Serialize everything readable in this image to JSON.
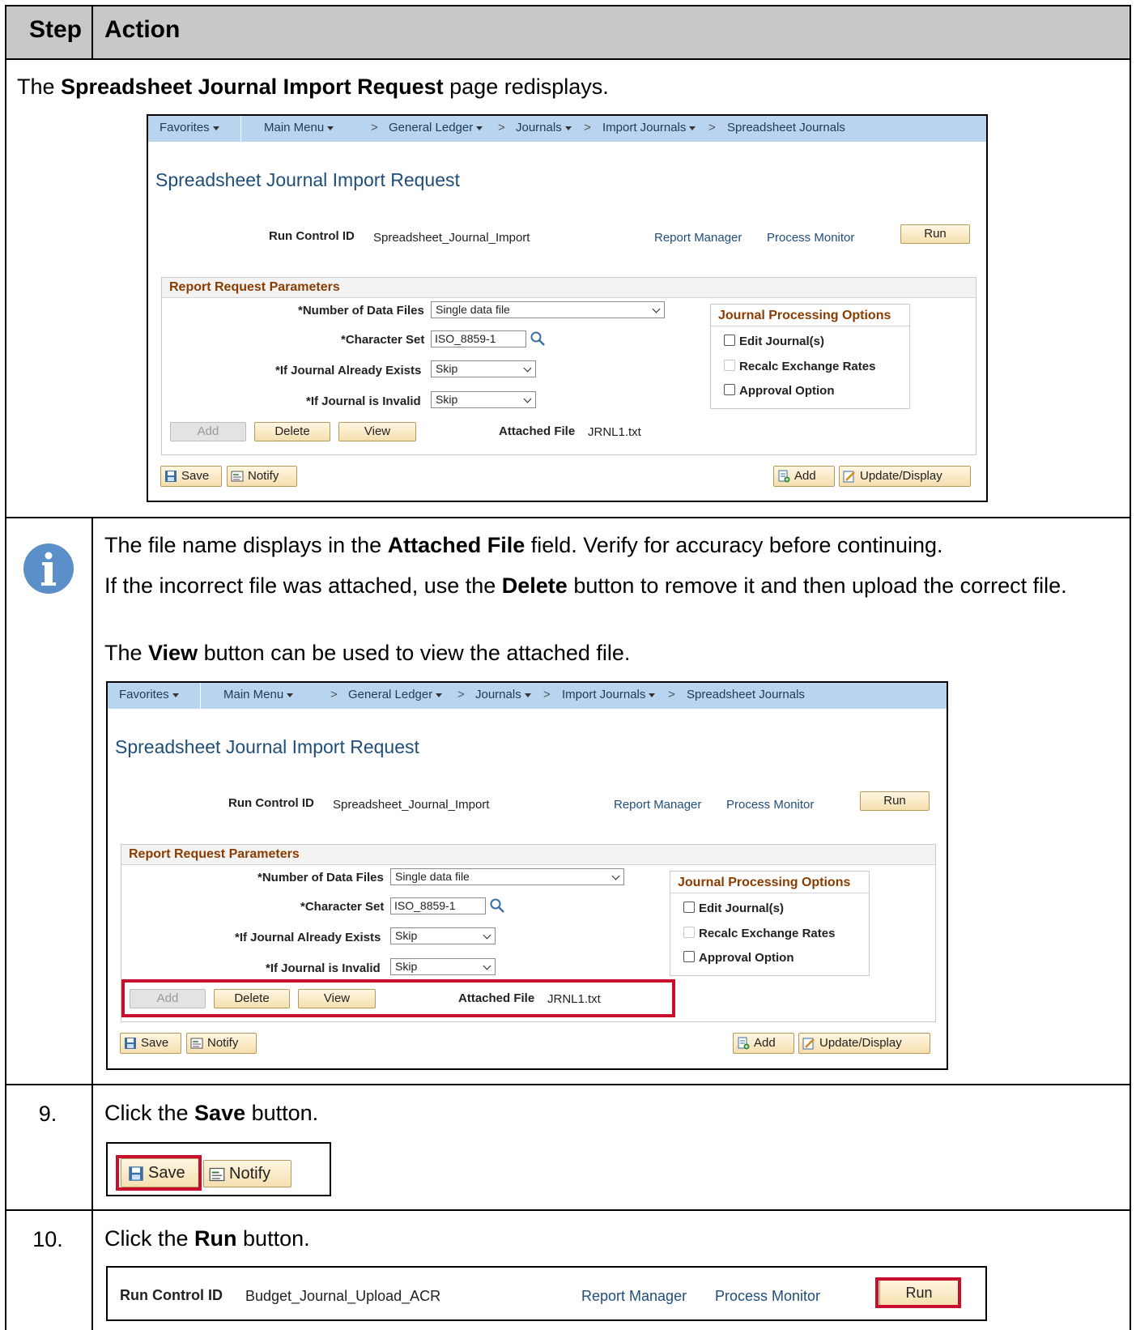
{
  "table": {
    "header": {
      "step": "Step",
      "action": "Action"
    },
    "row1": {
      "text_pre": "The ",
      "text_bold": "Spreadsheet Journal Import Request",
      "text_post": " page redisplays."
    },
    "info": {
      "p1_pre": "The file name displays in the ",
      "p1_bold": "Attached File",
      "p1_post": " field. Verify for accuracy before continuing.",
      "p2_pre": "If the incorrect file was attached, use the ",
      "p2_bold": "Delete",
      "p2_post": " button to remove it and then upload the correct file.",
      "p3_pre": "The ",
      "p3_bold": "View",
      "p3_post": " button can be used to view the attached file."
    },
    "step9": {
      "number": "9.",
      "text_pre": "Click the ",
      "text_bold": "Save",
      "text_post": " button."
    },
    "step10": {
      "number": "10.",
      "text_pre": "Click the ",
      "text_bold": "Run",
      "text_post": " button."
    }
  },
  "ps_page": {
    "nav": {
      "favorites": "Favorites",
      "main_menu": "Main Menu",
      "chevron": ">",
      "general_ledger": "General Ledger",
      "journals": "Journals",
      "import_journals": "Import Journals",
      "spreadsheet_journals": "Spreadsheet Journals"
    },
    "title": "Spreadsheet Journal Import Request",
    "run_control_label": "Run Control ID",
    "run_control_value": "Spreadsheet_Journal_Import",
    "report_manager": "Report Manager",
    "process_monitor": "Process Monitor",
    "run_button": "Run",
    "params": {
      "header": "Report Request Parameters",
      "num_files_label": "*Number of Data Files",
      "num_files_value": "Single data file",
      "charset_label": "*Character Set",
      "charset_value": "ISO_8859-1",
      "exists_label": "*If Journal Already Exists",
      "exists_value": "Skip",
      "invalid_label": "*If Journal is Invalid",
      "invalid_value": "Skip",
      "add_button": "Add",
      "delete_button": "Delete",
      "view_button": "View",
      "attached_label": "Attached File",
      "attached_value": "JRNL1.txt"
    },
    "options": {
      "header": "Journal Processing Options",
      "edit": "Edit Journal(s)",
      "recalc": "Recalc Exchange Rates",
      "approval": "Approval Option"
    },
    "footer": {
      "save": "Save",
      "notify": "Notify",
      "add": "Add",
      "update_display": "Update/Display"
    }
  },
  "run_panel": {
    "run_control_label": "Run Control ID",
    "run_control_value": "Budget_Journal_Upload_ACR",
    "report_manager": "Report Manager",
    "process_monitor": "Process Monitor",
    "run_button": "Run"
  },
  "colors": {
    "highlight": "#c8102e",
    "nav_bar": "#b9d4ef",
    "title_blue": "#1f4e79",
    "group_header": "#8a3c00",
    "info_icon": "#5b8fc9"
  },
  "icons": {
    "info": "info-circle-icon",
    "lookup": "magnifier-icon",
    "save": "floppy-disk-icon",
    "notify": "notify-message-icon",
    "add": "add-document-icon",
    "update": "update-pencil-icon"
  }
}
